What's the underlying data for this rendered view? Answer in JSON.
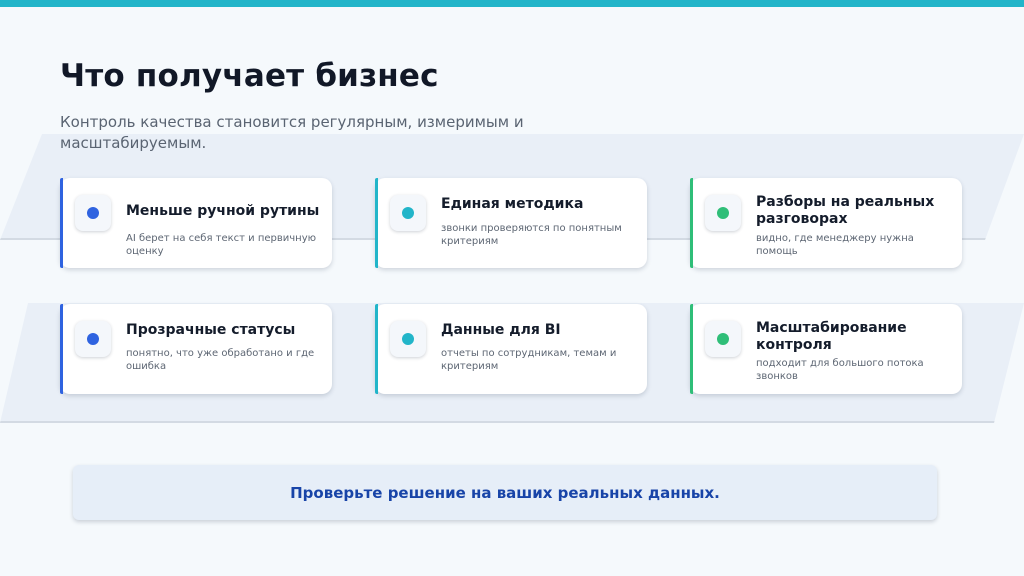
{
  "slide": {
    "title": "Что получает бизнес",
    "subtitle": "Контроль качества становится регулярным, измеримым и масштабируемым."
  },
  "colors": {
    "top_bar": "#22b5c9",
    "blue": "#2f63e0",
    "teal": "#22b5c9",
    "green": "#2fbe78",
    "cta_text": "#1844a8"
  },
  "cards": [
    {
      "title": "Меньше ручной рутины",
      "description": "AI берет на себя текст и первичную оценку",
      "color": "#2f63e0"
    },
    {
      "title": "Единая методика",
      "description": "звонки проверяются по понятным критериям",
      "color": "#22b5c9"
    },
    {
      "title": "Разборы на реальных разговорах",
      "description": "видно, где менеджеру нужна помощь",
      "color": "#2fbe78"
    },
    {
      "title": "Прозрачные статусы",
      "description": "понятно, что уже обработано и где ошибка",
      "color": "#2f63e0"
    },
    {
      "title": "Данные для BI",
      "description": "отчеты по сотрудникам, темам и критериям",
      "color": "#22b5c9"
    },
    {
      "title": "Масштабирование контроля",
      "description": "подходит для большого потока звонков",
      "color": "#2fbe78"
    }
  ],
  "cta": {
    "text": "Проверьте решение на ваших реальных данных."
  }
}
